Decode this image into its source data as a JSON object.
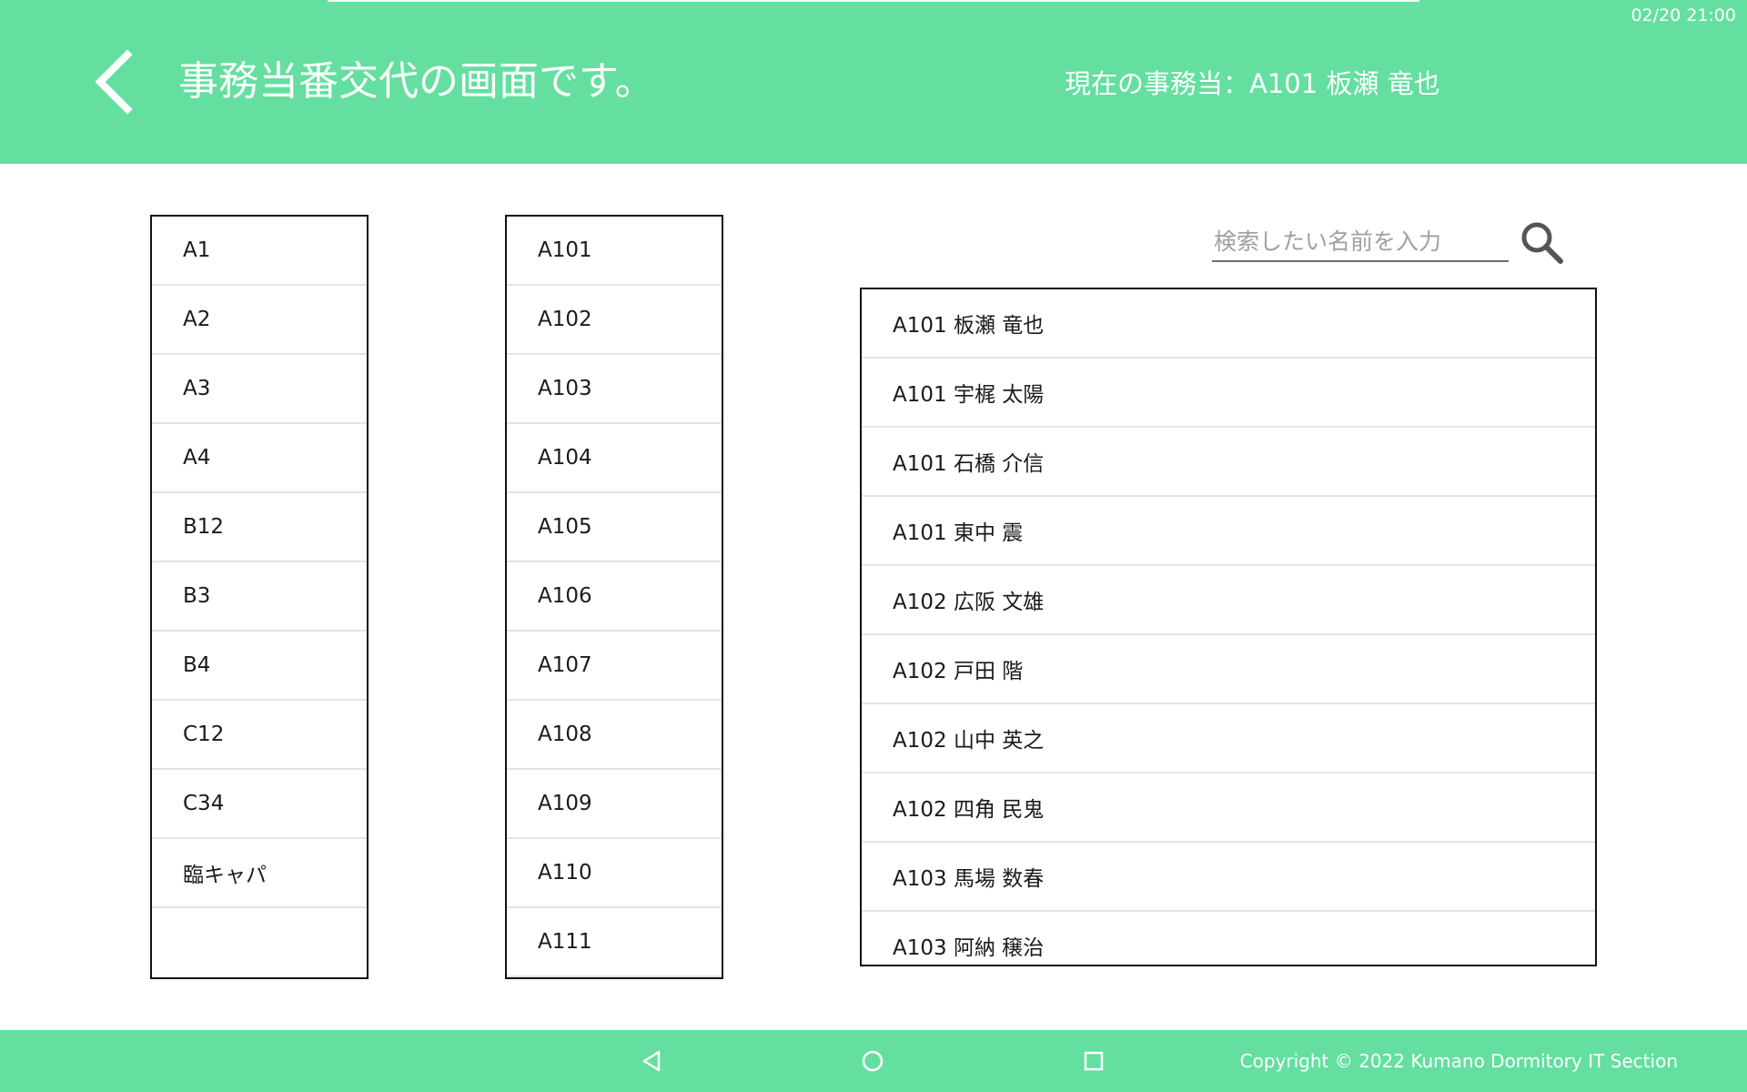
{
  "header": {
    "clock": "02/20 21:00",
    "title": "事務当番交代の画面です。",
    "current_duty": "現在の事務当：A101 板瀬 竜也",
    "back_icon": "chevron-left-icon"
  },
  "blocks": [
    "A1",
    "A2",
    "A3",
    "A4",
    "B12",
    "B3",
    "B4",
    "C12",
    "C34",
    "臨キャパ"
  ],
  "rooms": [
    "A101",
    "A102",
    "A103",
    "A104",
    "A105",
    "A106",
    "A107",
    "A108",
    "A109",
    "A110",
    "A111"
  ],
  "search": {
    "placeholder": "検索したい名前を入力",
    "value": "",
    "icon": "search-icon"
  },
  "people": [
    "A101 板瀬 竜也",
    "A101 宇梶 太陽",
    "A101 石橋 介信",
    "A101 東中 震",
    "A102 広阪 文雄",
    "A102 戸田 階",
    "A102 山中 英之",
    "A102 四角 民鬼",
    "A103 馬場 数春",
    "A103 阿納 穣治"
  ],
  "footer": {
    "copyright": "Copyright © 2022 Kumano Dormitory IT Section",
    "nav_icons": [
      "triangle-back-icon",
      "circle-home-icon",
      "square-recents-icon"
    ]
  },
  "colors": {
    "accent": "#64df9f",
    "text": "#1a1a1a",
    "header_text": "#ffffff"
  }
}
